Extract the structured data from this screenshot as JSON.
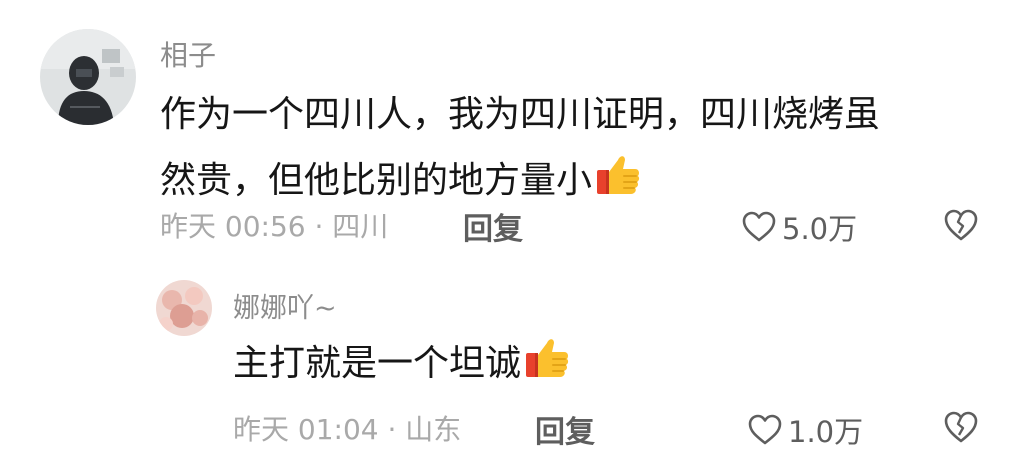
{
  "comments": [
    {
      "username": "相子",
      "text_lines": [
        "作为一个四川人，我为四川证明，四川烧烤虽",
        "然贵，但他比别的地方量小"
      ],
      "emoji": "thumbs-up-icon",
      "meta": "昨天 00:56 · 四川",
      "reply_label": "回复",
      "like_count": "5.0万"
    },
    {
      "username": "娜娜吖~",
      "text_lines": [
        "主打就是一个坦诚"
      ],
      "emoji": "thumbs-up-icon",
      "meta": "昨天 01:04 · 山东",
      "reply_label": "回复",
      "like_count": "1.0万"
    }
  ],
  "colors": {
    "username": "#8c8c8c",
    "text": "#161616",
    "meta": "#a9a9a9",
    "action": "#5e5e5e"
  }
}
